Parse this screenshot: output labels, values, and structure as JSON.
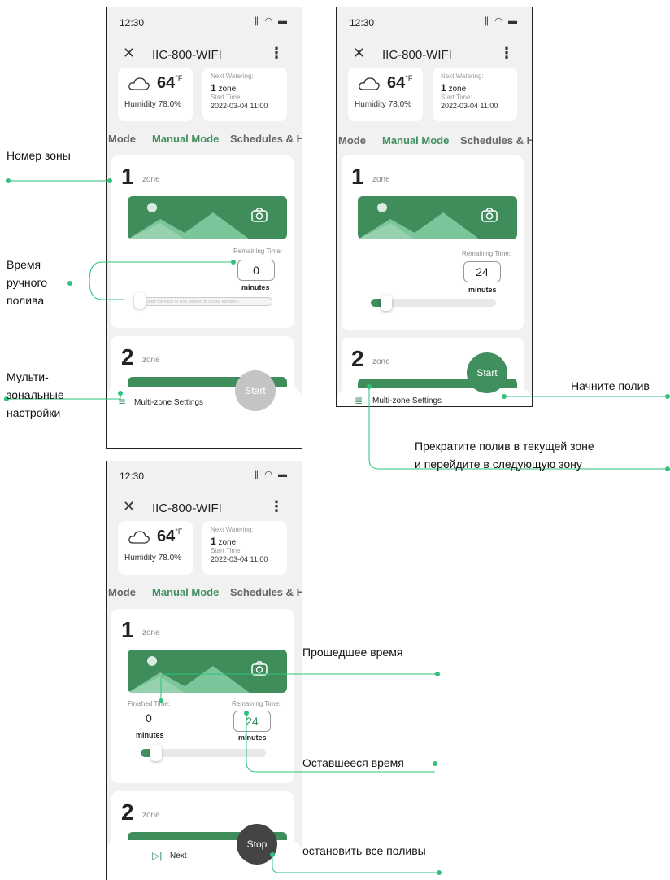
{
  "status": {
    "time": "12:30",
    "icons": "signal wifi battery"
  },
  "app": {
    "close_icon": "close-icon",
    "title": "IIC-800-WIFI",
    "more_icon": "more-vertical-icon"
  },
  "weather": {
    "temp": "64",
    "unit": "°F",
    "humidity": "Humidity  78.0%"
  },
  "next_watering": {
    "label": "Next Watering:",
    "zone_num": "1",
    "zone_word": "zone",
    "start_label": "Start Time:",
    "start_time": "2022-03-04 11:00"
  },
  "tabs": [
    "Mode",
    "Manual Mode",
    "Schedules & Hi"
  ],
  "zone_word": "zone",
  "zone1": "1",
  "zone2": "2",
  "remaining_label": "Remaining Time:",
  "finished_label": "Finished Time:",
  "minutes": "minutes",
  "slider_hint": "Slide the block or click minutes to set the duration...",
  "screens": {
    "s1": {
      "remaining": "0",
      "progress": 0
    },
    "s2": {
      "remaining": "24",
      "progress": 0.1
    },
    "s3": {
      "finished": "0",
      "remaining": "24",
      "progress": 0.1
    }
  },
  "multizone": "Multi-zone Settings",
  "next_label": "Next",
  "start_label": "Start",
  "stop_label": "Stop",
  "annotations": {
    "zone_number": "Номер зоны",
    "manual_time_1": "Время",
    "manual_time_2": "ручного",
    "manual_time_3": "полива",
    "multizone_1": "Мульти-",
    "multizone_2": "зональные",
    "multizone_3": "настройки",
    "start_watering": "Начните полив",
    "stop_next_1": "Прекратите полив в текущей зоне",
    "stop_next_2": "и перейдите в следующую зону",
    "elapsed": "Прошедшее время",
    "remaining": "Оставшееся время",
    "stop_all": "остановить все поливы"
  },
  "colors": {
    "accent": "#3f8f5f",
    "banner": "#3e8d5b",
    "connector": "#2ec27e",
    "stop": "#444444",
    "start_disabled": "#c4c4c4"
  }
}
